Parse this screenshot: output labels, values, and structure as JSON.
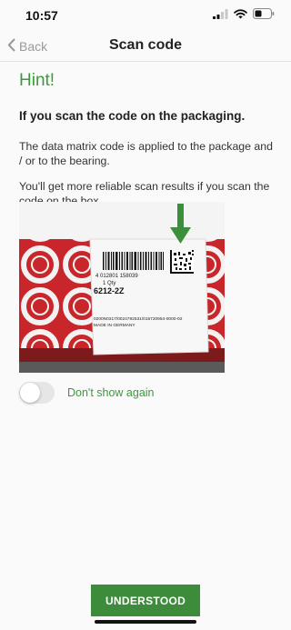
{
  "status_bar": {
    "time": "10:57",
    "icons": [
      "signal-icon",
      "wifi-icon",
      "battery-icon"
    ]
  },
  "nav": {
    "back_label": "Back",
    "title": "Scan code"
  },
  "hint": {
    "title": "Hint!",
    "heading": "If you scan the code on the packaging.",
    "paragraph_1": "The data matrix code is applied to the package and / or to the bearing.",
    "paragraph_2": "You'll get more reliable scan results if you scan the code on the box."
  },
  "image": {
    "barcode_number": "4 012801 158039",
    "qty_label": "1 Qty",
    "part_number": "6212-2Z",
    "code_line": "0200N0317/0024792531/016720954-0000-02",
    "origin": "MADE IN GERMANY",
    "brand": "FAG"
  },
  "toggle": {
    "label": "Don't show again",
    "checked": false
  },
  "actions": {
    "understood_label": "UNDERSTOOD"
  },
  "colors": {
    "accent": "#3a9a3a",
    "button": "#3c8c3c",
    "box_red": "#c8262a"
  }
}
